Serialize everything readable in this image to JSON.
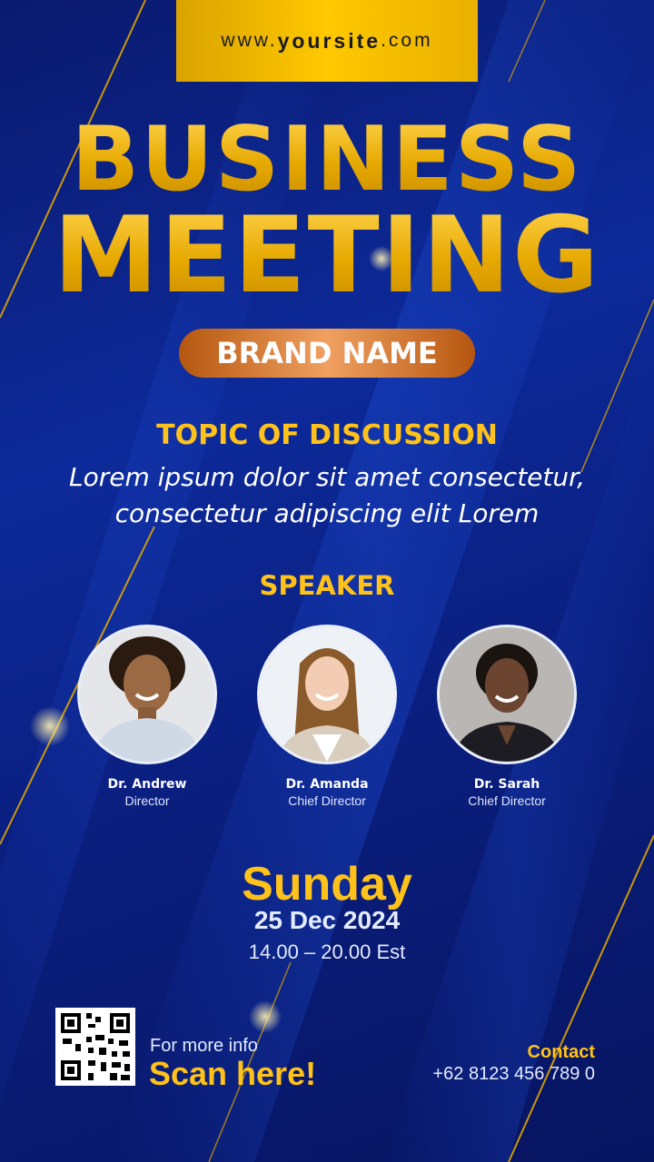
{
  "header": {
    "site_prefix": "www.",
    "site_name": "yoursite",
    "site_suffix": ".com"
  },
  "title": {
    "line1": "BUSINESS",
    "line2": "MEETING"
  },
  "brand": {
    "label": "BRAND NAME"
  },
  "topic": {
    "heading": "TOPIC OF DISCUSSION",
    "line1": "Lorem ipsum dolor sit amet consectetur,",
    "line2": "consectetur adipiscing elit Lorem"
  },
  "speakers": {
    "heading": "SPEAKER",
    "items": [
      {
        "name": "Dr. Andrew",
        "role": "Director"
      },
      {
        "name": "Dr. Amanda",
        "role": "Chief Director"
      },
      {
        "name": "Dr. Sarah",
        "role": "Chief Director"
      }
    ]
  },
  "event": {
    "day": "Sunday",
    "date": "25 Dec 2024",
    "time": "14.00 – 20.00 Est"
  },
  "footer": {
    "more_info": "For more info",
    "scan": "Scan here!",
    "contact_label": "Contact",
    "phone": "+62 8123 456 789 0"
  },
  "colors": {
    "background": "#0d2a9a",
    "gold": "#ffc21a",
    "brand_pill": "#d97a35"
  }
}
